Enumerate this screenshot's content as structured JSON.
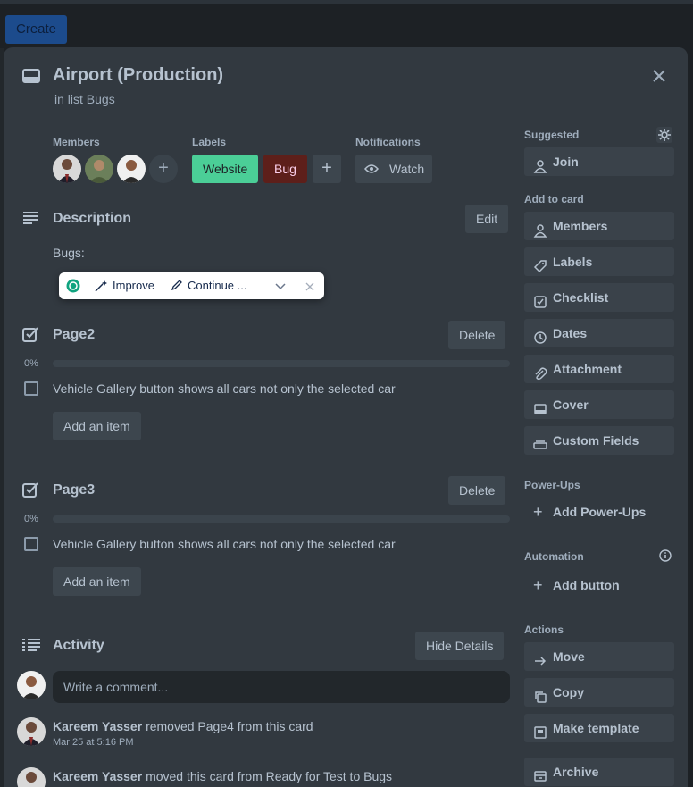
{
  "topbar": {
    "create_label": "Create"
  },
  "card": {
    "title": "Airport (Production)",
    "in_list_prefix": "in list",
    "list_name": "Bugs"
  },
  "members": {
    "label": "Members",
    "add": "+"
  },
  "labels": {
    "label": "Labels",
    "items": [
      {
        "text": "Website",
        "color": "#4bce97",
        "text_color": "#1d2125"
      },
      {
        "text": "Bug",
        "color": "#5d1f1a",
        "text_color": "#fdd0ec"
      }
    ],
    "add": "+"
  },
  "notifications": {
    "label": "Notifications",
    "watch": "Watch"
  },
  "description": {
    "heading": "Description",
    "edit": "Edit",
    "body": "Bugs:"
  },
  "ai_toolbar": {
    "improve": "Improve",
    "continue": "Continue ..."
  },
  "checklists": [
    {
      "title": "Page2",
      "delete": "Delete",
      "percent": "0%",
      "progress": 0,
      "item": "Vehicle Gallery button shows all cars not only the selected car",
      "add_item": "Add an item"
    },
    {
      "title": "Page3",
      "delete": "Delete",
      "percent": "0%",
      "progress": 0,
      "item": "Vehicle Gallery button shows all cars not only the selected car",
      "add_item": "Add an item"
    }
  ],
  "activity": {
    "heading": "Activity",
    "hide_details": "Hide Details",
    "comment_placeholder": "Write a comment...",
    "entries": [
      {
        "user": "Kareem Yasser",
        "action": "removed Page4 from this card",
        "time": "Mar 25 at 5:16 PM"
      },
      {
        "user": "Kareem Yasser",
        "action": "moved this card from Ready for Test to Bugs",
        "time": ""
      }
    ]
  },
  "sidebar": {
    "suggested": "Suggested",
    "join": "Join",
    "add_to_card": "Add to card",
    "add_items": [
      "Members",
      "Labels",
      "Checklist",
      "Dates",
      "Attachment",
      "Cover",
      "Custom Fields"
    ],
    "power_ups": "Power-Ups",
    "add_power_ups": "Add Power-Ups",
    "automation": "Automation",
    "add_button": "Add button",
    "actions": "Actions",
    "action_items": [
      "Move",
      "Copy",
      "Make template",
      "Archive"
    ]
  }
}
